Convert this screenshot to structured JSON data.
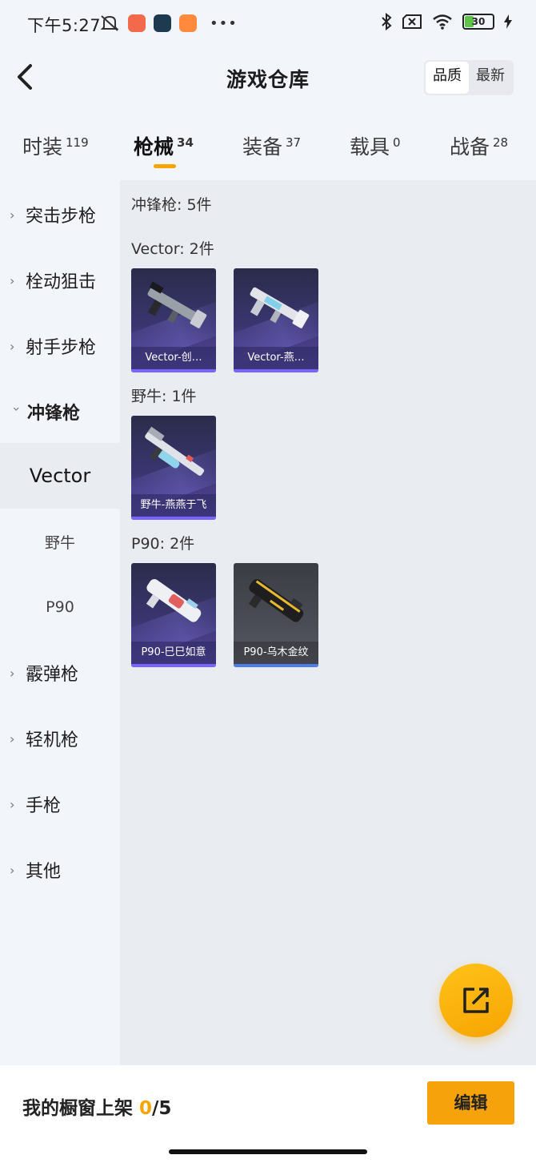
{
  "status_bar": {
    "time": "下午5:27",
    "battery": "30",
    "icons": [
      "mute-icon",
      "app-red-icon",
      "app-game-icon",
      "app-orange-icon",
      "more-dots-icon",
      "bluetooth-icon",
      "sim-off-icon",
      "wifi-icon",
      "battery-icon",
      "charging-icon"
    ]
  },
  "header": {
    "title": "游戏仓库",
    "sort_options": [
      "品质",
      "最新"
    ],
    "active_sort": "品质"
  },
  "tabs": [
    {
      "label": "时装",
      "count": "119"
    },
    {
      "label": "枪械",
      "count": "34"
    },
    {
      "label": "装备",
      "count": "37"
    },
    {
      "label": "载具",
      "count": "0"
    },
    {
      "label": "战备",
      "count": "28"
    }
  ],
  "active_tab": "枪械",
  "sidebar": {
    "items": [
      {
        "label": "突击步枪"
      },
      {
        "label": "栓动狙击"
      },
      {
        "label": "射手步枪"
      },
      {
        "label": "冲锋枪"
      },
      {
        "label": "Vector"
      },
      {
        "label": "野牛"
      },
      {
        "label": "P90"
      },
      {
        "label": "霰弹枪"
      },
      {
        "label": "轻机枪"
      },
      {
        "label": "手枪"
      },
      {
        "label": "其他"
      }
    ]
  },
  "content": {
    "category_title": "冲锋枪: 5件",
    "groups": [
      {
        "title": "Vector: 2件",
        "items": [
          {
            "name": "Vector-创…"
          },
          {
            "name": "Vector-燕…"
          }
        ]
      },
      {
        "title": "野牛: 1件",
        "items": [
          {
            "name": "野牛-燕燕于飞"
          }
        ]
      },
      {
        "title": "P90: 2件",
        "items": [
          {
            "name": "P90-巳巳如意"
          },
          {
            "name": "P90-乌木金纹"
          }
        ]
      }
    ]
  },
  "footer": {
    "shelf_label": "我的橱窗上架",
    "shelf_current": "0",
    "shelf_total": "/5",
    "edit_label": "编辑"
  },
  "colors": {
    "accent": "#f5a500",
    "rarity_purple": "#7a63ff",
    "rarity_blue": "#4f7ee8"
  }
}
